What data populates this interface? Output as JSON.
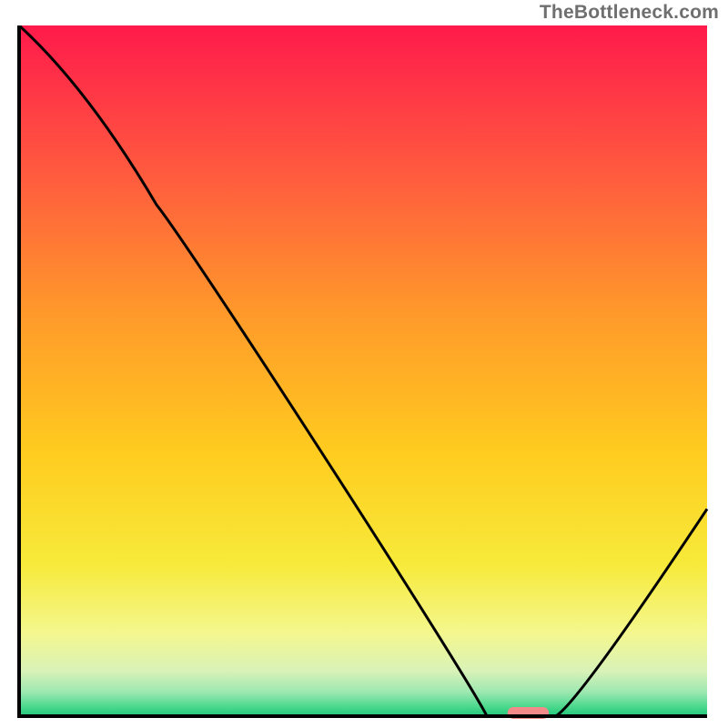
{
  "attribution": "TheBottleneck.com",
  "chart_data": {
    "type": "line",
    "title": "",
    "xlabel": "",
    "ylabel": "",
    "xlim": [
      0,
      100
    ],
    "ylim": [
      0,
      100
    ],
    "series": [
      {
        "name": "curve",
        "points": [
          {
            "x": 0.0,
            "y": 100.0
          },
          {
            "x": 20.0,
            "y": 74.0
          },
          {
            "x": 68.0,
            "y": 0.0
          },
          {
            "x": 78.0,
            "y": 0.0
          },
          {
            "x": 100.0,
            "y": 30.0
          }
        ]
      }
    ],
    "marker": {
      "x_start": 71.0,
      "x_end": 77.0,
      "y": 0.0,
      "color": "#f28a8a"
    },
    "gradient_stops": [
      {
        "offset": 0.0,
        "color": "#ff1a4b"
      },
      {
        "offset": 0.2,
        "color": "#ff5640"
      },
      {
        "offset": 0.42,
        "color": "#ff9a2a"
      },
      {
        "offset": 0.62,
        "color": "#ffcc1f"
      },
      {
        "offset": 0.78,
        "color": "#f7ea3a"
      },
      {
        "offset": 0.88,
        "color": "#f4f78e"
      },
      {
        "offset": 0.935,
        "color": "#d8f2b8"
      },
      {
        "offset": 0.965,
        "color": "#9de8b1"
      },
      {
        "offset": 0.985,
        "color": "#4fd98f"
      },
      {
        "offset": 1.0,
        "color": "#20c879"
      }
    ],
    "axis_color": "#000000",
    "curve_color": "#000000"
  }
}
